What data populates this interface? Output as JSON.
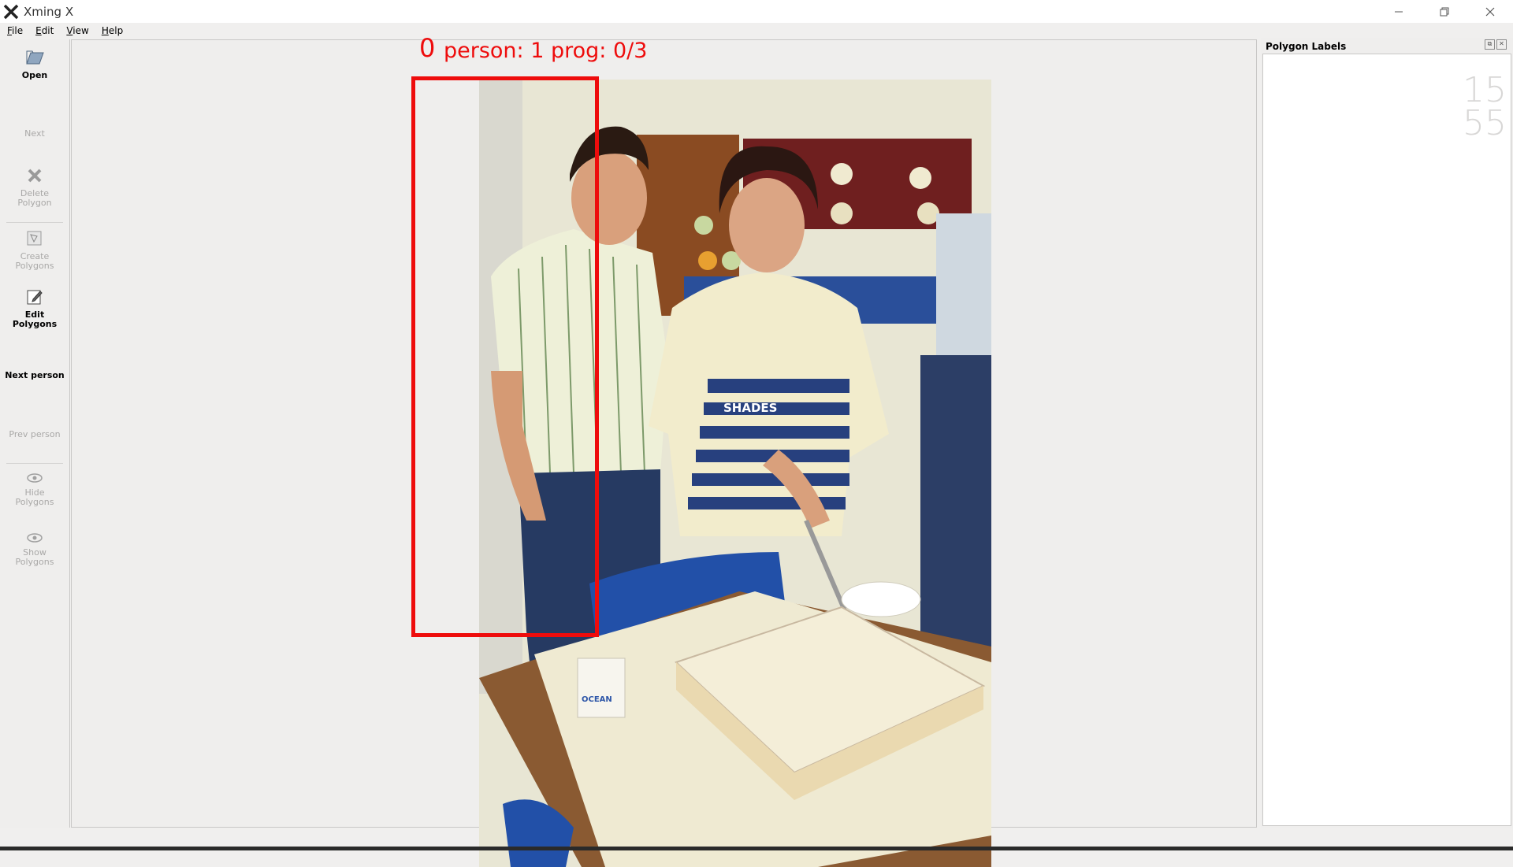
{
  "window": {
    "title": "Xming X",
    "controls": [
      "minimize-icon",
      "restore-icon",
      "close-icon"
    ]
  },
  "menu": [
    "File",
    "Edit",
    "View",
    "Help"
  ],
  "toolbar": {
    "open": "Open",
    "next": "Next",
    "delete_polygon": "Delete\nPolygon",
    "create_polygons": "Create\nPolygons",
    "edit_polygons": "Edit\nPolygons",
    "next_person": "Next person",
    "prev_person": "Prev person",
    "hide_polygons": "Hide\nPolygons",
    "show_polygons": "Show\nPolygons"
  },
  "canvas": {
    "bbox_index": "0",
    "bbox_caption": "person: 1 prog: 0/3",
    "bbox_color": "#ee0c0c",
    "photo_text_shirt": "SHADES",
    "photo_text_mug": "OCEAN"
  },
  "labels_panel": {
    "title": "Polygon Labels",
    "clock_hour": "15",
    "clock_min": "55"
  }
}
